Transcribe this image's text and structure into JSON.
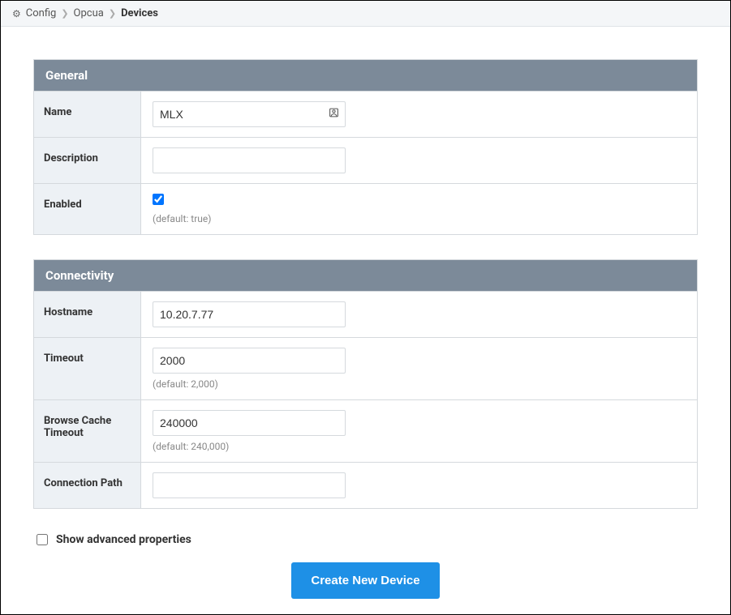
{
  "breadcrumb": {
    "items": [
      "Config",
      "Opcua"
    ],
    "current": "Devices"
  },
  "sections": {
    "general": {
      "title": "General",
      "fields": {
        "name": {
          "label": "Name",
          "value": "MLX"
        },
        "description": {
          "label": "Description",
          "value": ""
        },
        "enabled": {
          "label": "Enabled",
          "checked": true,
          "hint": "(default: true)"
        }
      }
    },
    "connectivity": {
      "title": "Connectivity",
      "fields": {
        "hostname": {
          "label": "Hostname",
          "value": "10.20.7.77"
        },
        "timeout": {
          "label": "Timeout",
          "value": "2000",
          "hint": "(default: 2,000)"
        },
        "browseCacheTimeout": {
          "label": "Browse Cache Timeout",
          "value": "240000",
          "hint": "(default: 240,000)"
        },
        "connectionPath": {
          "label": "Connection Path",
          "value": ""
        }
      }
    }
  },
  "advanced": {
    "label": "Show advanced properties",
    "checked": false
  },
  "actions": {
    "create": "Create New Device"
  }
}
